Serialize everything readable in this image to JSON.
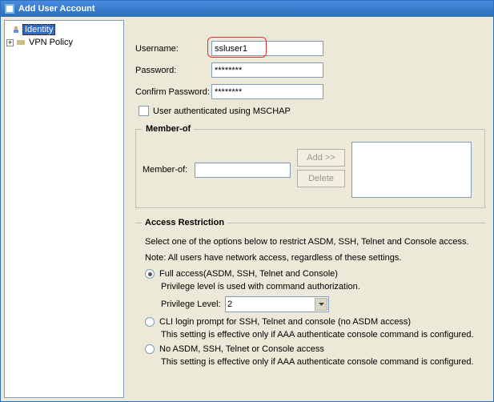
{
  "window": {
    "title": "Add User Account"
  },
  "sidebar": {
    "items": [
      {
        "label": "Identity"
      },
      {
        "label": "VPN Policy"
      }
    ]
  },
  "form": {
    "username_label": "Username:",
    "username_value": "ssluser1",
    "password_label": "Password:",
    "password_value": "********",
    "confirm_label": "Confirm Password:",
    "confirm_value": "********",
    "mschap_label": "User authenticated using MSCHAP"
  },
  "member": {
    "legend": "Member-of",
    "label": "Member-of:",
    "input_value": "",
    "add_btn": "Add >>",
    "delete_btn": "Delete"
  },
  "access": {
    "legend": "Access Restriction",
    "intro1": "Select one of the options below to restrict ASDM, SSH, Telnet and Console access.",
    "intro2": "Note: All users have network access, regardless of these settings.",
    "opt1": "Full access(ASDM, SSH, Telnet and Console)",
    "opt1_sub": "Privilege level is used with command authorization.",
    "priv_label": "Privilege Level:",
    "priv_value": "2",
    "opt2": "CLI login prompt for SSH, Telnet and console (no ASDM access)",
    "opt2_sub": "This setting is effective only if AAA authenticate console command is configured.",
    "opt3": "No ASDM, SSH, Telnet or Console access",
    "opt3_sub": "This setting is effective only if AAA authenticate console command is configured."
  }
}
